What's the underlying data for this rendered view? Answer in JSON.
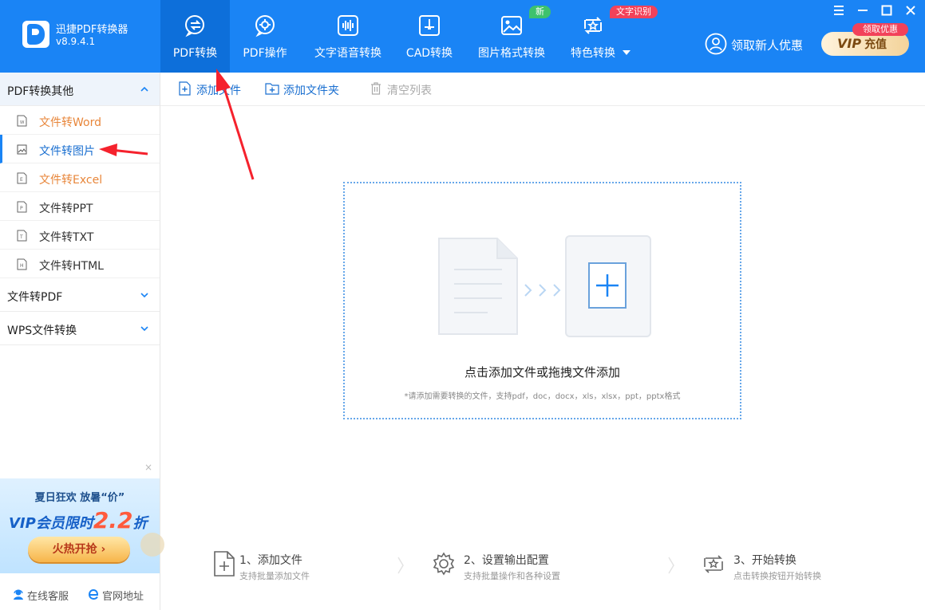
{
  "app": {
    "name": "迅捷PDF转换器",
    "version": "v8.9.4.1"
  },
  "nav": {
    "items": [
      {
        "label": "PDF转换",
        "icon": "convert-icon"
      },
      {
        "label": "PDF操作",
        "icon": "gear-doc-icon"
      },
      {
        "label": "文字语音转换",
        "icon": "audio-wave-icon"
      },
      {
        "label": "CAD转换",
        "icon": "cad-icon"
      },
      {
        "label": "图片格式转换",
        "icon": "image-icon",
        "badge": "新"
      },
      {
        "label": "特色转换",
        "icon": "star-cycle-icon",
        "badge": "文字识别"
      }
    ],
    "active_index": 0
  },
  "header": {
    "promo_text": "领取新人优惠",
    "vip_label": "VIP",
    "vip_sub": "充值",
    "vip_tag": "领取优惠"
  },
  "sidebar": {
    "groups": [
      {
        "title": "PDF转换其他",
        "expanded": true,
        "items": [
          {
            "label": "文件转Word",
            "icon": "word-file-icon",
            "glyph": "W",
            "color": "#e8863a"
          },
          {
            "label": "文件转图片",
            "icon": "image-file-icon",
            "glyph": "",
            "color": "#1a6fd0",
            "active": true
          },
          {
            "label": "文件转Excel",
            "icon": "excel-file-icon",
            "glyph": "E",
            "color": "#e8863a"
          },
          {
            "label": "文件转PPT",
            "icon": "ppt-file-icon",
            "glyph": "P",
            "color": "#333333"
          },
          {
            "label": "文件转TXT",
            "icon": "txt-file-icon",
            "glyph": "T",
            "color": "#333333"
          },
          {
            "label": "文件转HTML",
            "icon": "html-file-icon",
            "glyph": "H",
            "color": "#333333"
          }
        ]
      },
      {
        "title": "文件转PDF",
        "expanded": false
      },
      {
        "title": "WPS文件转换",
        "expanded": false
      }
    ],
    "ad": {
      "line1": "夏日狂欢 放暑“价”",
      "line2": "VIP会员限时",
      "discount": "2.2",
      "unit": "折",
      "button": "火热开抢 ›",
      "close": "×"
    },
    "footer": [
      {
        "label": "在线客服",
        "icon": "support-icon"
      },
      {
        "label": "官网地址",
        "icon": "browser-icon"
      }
    ]
  },
  "toolbar": {
    "add_file": "添加文件",
    "add_folder": "添加文件夹",
    "clear_list": "清空列表"
  },
  "dropzone": {
    "title": "点击添加文件或拖拽文件添加",
    "hint": "*请添加需要转换的文件，支持pdf，doc，docx，xls，xlsx，ppt，pptx格式"
  },
  "steps": [
    {
      "title": "1、添加文件",
      "sub": "支持批量添加文件"
    },
    {
      "title": "2、设置输出配置",
      "sub": "支持批量操作和各种设置"
    },
    {
      "title": "3、开始转换",
      "sub": "点击转换按钮开始转换"
    }
  ],
  "colors": {
    "brand": "#1a84f5",
    "active_nav": "#0d6fda",
    "link": "#1a6fd0",
    "highlight": "#e8863a",
    "annotation": "#f5222d"
  }
}
